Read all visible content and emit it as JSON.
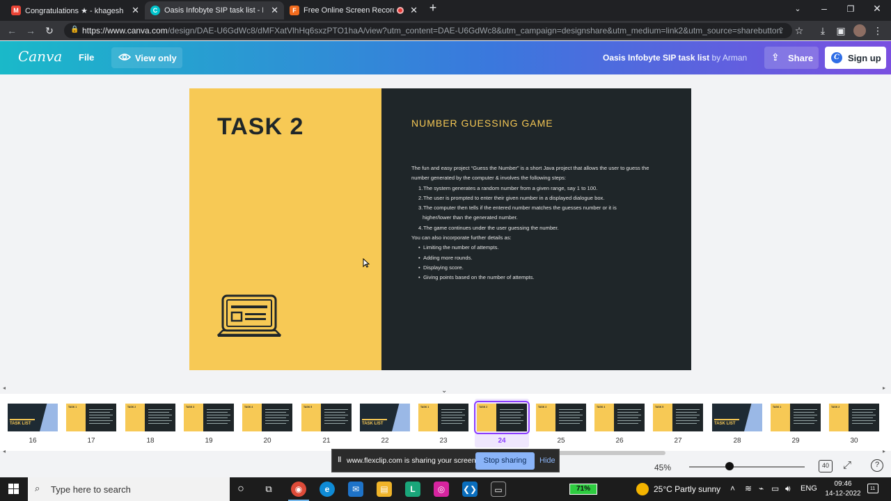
{
  "browser": {
    "tabs": [
      {
        "title": "Congratulations ★ - khageshp...",
        "icon": "gmail-icon",
        "color": "#ea4335",
        "active": false
      },
      {
        "title": "Oasis Infobyte SIP task list - Pres",
        "icon": "canva-icon",
        "color": "#00c4cc",
        "active": true
      },
      {
        "title": "Free Online Screen Recorder",
        "icon": "flexclip-icon",
        "color": "#f26b1d",
        "active": false
      }
    ],
    "new_tab_label": "+",
    "url_host": "https://www.canva.com",
    "url_path": "/design/DAE-U6GdWc8/dMFXatVlhHq6sxzPTO1haA/view?utm_content=DAE-U6GdWc8&utm_campaign=designshare&utm_medium=link2&utm_source=sharebutton"
  },
  "canva_header": {
    "logo": "Canva",
    "file_label": "File",
    "view_only_label": "View only",
    "doc_title": "Oasis Infobyte SIP task list",
    "doc_author": "by Arman",
    "share_label": "Share",
    "signup_label": "Sign up"
  },
  "slide": {
    "task_title": "TASK 2",
    "game_title": "NUMBER GUESSING GAME",
    "intro": "The fun and easy project “Guess the Number” is a short Java project that allows the user to guess the number generated by the computer & involves the following steps:",
    "steps": [
      {
        "n": "1.",
        "text": "The system generates a random number from a given range, say 1 to 100."
      },
      {
        "n": "2.",
        "text": "The user is prompted to enter their given number in a displayed dialogue box."
      },
      {
        "n": "3.",
        "text": "The computer then tells if the entered number matches the guesses number or it is",
        "cont": "higher/lower than the generated number."
      },
      {
        "n": "4.",
        "text": "The game continues under the user guessing the number."
      }
    ],
    "further": "You can also incorporate further details as:",
    "bullets": [
      "Limiting the number of attempts.",
      "Adding more rounds.",
      "Displaying score.",
      "Giving points based on the number of attempts."
    ],
    "left_color": "#f7c955",
    "right_color": "#1f2629"
  },
  "thumbnails": {
    "pages": [
      {
        "num": "16",
        "kind": "cover",
        "label": "TASK LIST"
      },
      {
        "num": "17",
        "kind": "task",
        "label": "TASK 1"
      },
      {
        "num": "18",
        "kind": "task",
        "label": "TASK 2"
      },
      {
        "num": "19",
        "kind": "task",
        "label": "TASK 3"
      },
      {
        "num": "20",
        "kind": "task",
        "label": "TASK 4"
      },
      {
        "num": "21",
        "kind": "task",
        "label": "TASK 5"
      },
      {
        "num": "22",
        "kind": "cover",
        "label": "TASK LIST"
      },
      {
        "num": "23",
        "kind": "task",
        "label": "TASK 1"
      },
      {
        "num": "24",
        "kind": "task",
        "label": "TASK 2"
      },
      {
        "num": "25",
        "kind": "task",
        "label": "TASK 3"
      },
      {
        "num": "26",
        "kind": "task",
        "label": "TASK 4"
      },
      {
        "num": "27",
        "kind": "task",
        "label": "TASK 5"
      },
      {
        "num": "28",
        "kind": "cover",
        "label": "TASK LIST"
      },
      {
        "num": "29",
        "kind": "task",
        "label": "TASK 1"
      },
      {
        "num": "30",
        "kind": "task",
        "label": "TASK 2"
      }
    ],
    "selected": "24"
  },
  "controls": {
    "zoom": "45%",
    "zoom_fraction": 0.35,
    "page_count": "40",
    "help": "?"
  },
  "share_banner": {
    "message": "www.flexclip.com is sharing your screen.",
    "stop_label": "Stop sharing",
    "hide_label": "Hide"
  },
  "taskbar": {
    "search_placeholder": "Type here to search",
    "battery": "71%",
    "weather": "25°C  Partly sunny",
    "language": "ENG",
    "time": "09:46",
    "date": "14-12-2022",
    "notification_count": "11"
  }
}
